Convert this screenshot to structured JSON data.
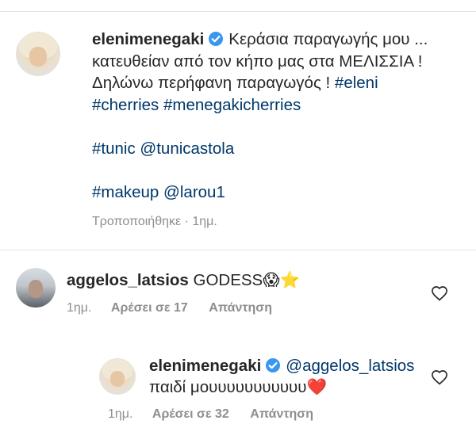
{
  "post": {
    "username": "elenimenegaki",
    "verified": true,
    "caption_line1": "Κεράσια παραγωγής μου ...",
    "caption_line2": "κατευθείαν από τον κήπο μας στα ΜΕΛΙΣΣΙΑ !",
    "caption_line3_text": "Δηλώνω περήφανη παραγωγός ! ",
    "hashtag_eleni": "#eleni",
    "hashtag_cherries": "#cherries",
    "hashtag_menegakicherries": "#menegakicherries",
    "hashtag_tunic": "#tunic",
    "mention_tunicastola": "@tunicastola",
    "hashtag_makeup": "#makeup",
    "mention_larou1": "@larou1",
    "edited_label": "Τροποποιήθηκε · 1ημ."
  },
  "comments": [
    {
      "username": "aggelos_latsios",
      "text": "GODESS😱⭐",
      "time": "1ημ.",
      "likes_label": "Αρέσει σε 17",
      "reply_label": "Απάντηση"
    }
  ],
  "reply": {
    "username": "elenimenegaki",
    "verified": true,
    "mention": "@aggelos_latsios",
    "text": "παιδί μουυυυυυυυυυυ❤️",
    "time": "1ημ.",
    "likes_label": "Αρέσει σε 32",
    "reply_label": "Απάντηση"
  },
  "colors": {
    "link": "#00376b",
    "secondary": "#8e8e8e",
    "verified": "#3897f0"
  },
  "icons": [
    "verified-badge-icon",
    "heart-icon"
  ]
}
